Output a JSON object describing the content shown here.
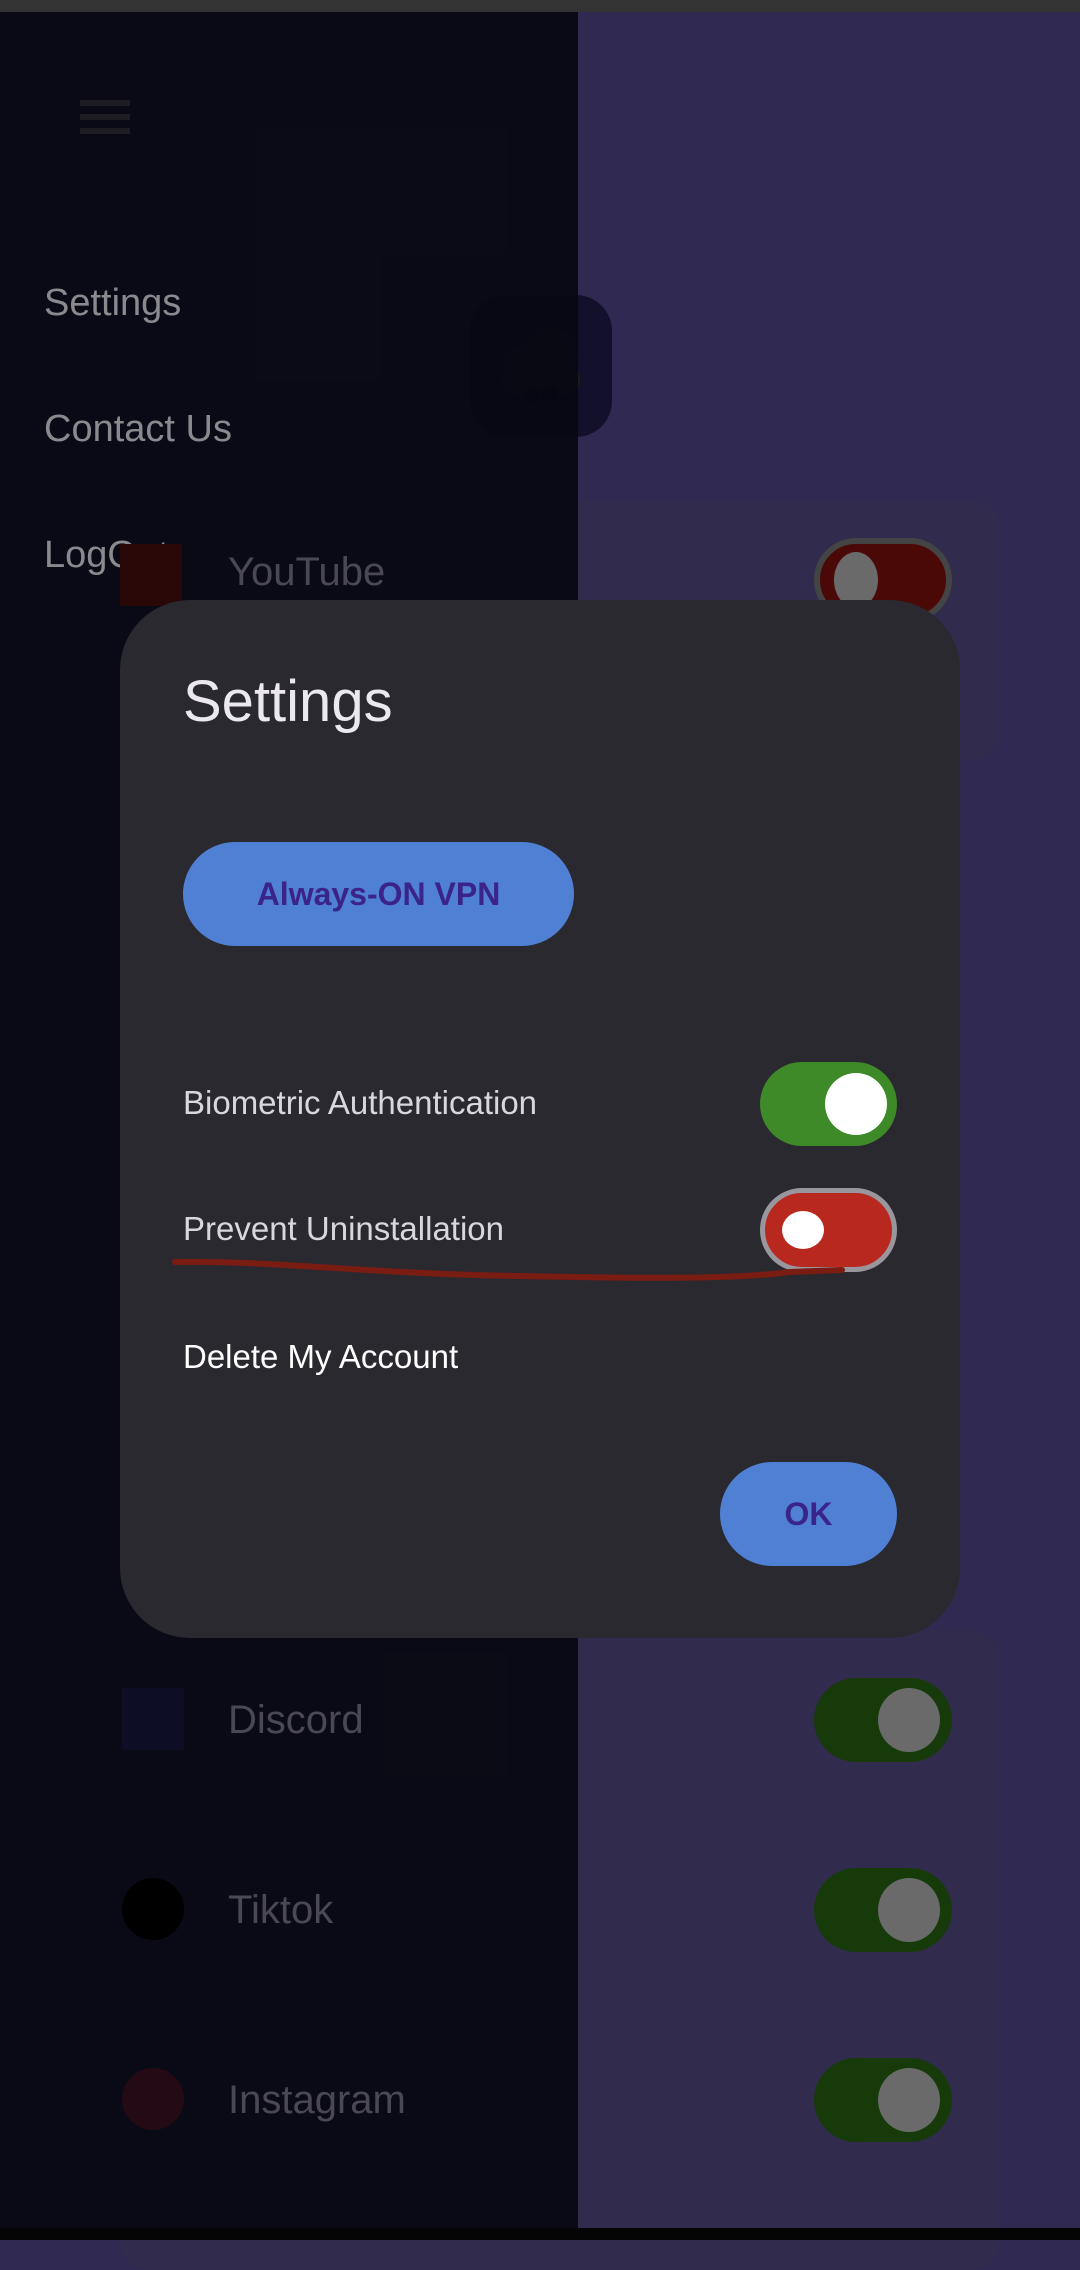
{
  "drawer": {
    "menu": [
      {
        "label": "Settings"
      },
      {
        "label": "Contact Us"
      },
      {
        "label": "LogOut"
      }
    ]
  },
  "apps": [
    {
      "name": "YouTube",
      "enabled": false,
      "icon": "youtube-icon"
    },
    {
      "name": "Discord",
      "enabled": true,
      "icon": "discord-icon"
    },
    {
      "name": "Tiktok",
      "enabled": true,
      "icon": "tiktok-icon"
    },
    {
      "name": "Instagram",
      "enabled": true,
      "icon": "instagram-icon"
    }
  ],
  "dialog": {
    "title": "Settings",
    "vpn_button": "Always-ON VPN",
    "biometric": {
      "label": "Biometric Authentication",
      "enabled": true
    },
    "prevent_uninstall": {
      "label": "Prevent Uninstallation",
      "enabled": false
    },
    "delete_account": "Delete My Account",
    "ok": "OK"
  },
  "colors": {
    "accent": "#4f80d4",
    "accent_text": "#3a2389",
    "on": "#3e8a28",
    "off": "#b8281f",
    "background": "#302a52",
    "dialog": "#2a2930"
  }
}
